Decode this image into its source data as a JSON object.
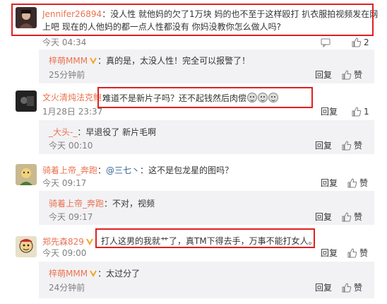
{
  "comments": [
    {
      "user": "Jennifer26894",
      "text1": "没人性 就他妈的欠了1万块 妈的也不至于这样殴打 扒衣服拍视频发在网",
      "text2": "上吧  现在的人他妈的都一点人性都没有  你妈没教你怎么做人吗?",
      "time": "今天 04:34",
      "likes": "2"
    },
    {
      "user": "梓萌MMM",
      "text": "真的是，太没人性！完全可以报警了！",
      "time": "25分钟前",
      "reply": "回复",
      "like_label": "赞"
    },
    {
      "user": "文火清炖法克鲍",
      "text": "难道不是新片子吗？还不起钱然后肉偿",
      "time": "1月28日 23:37",
      "reply": "回复",
      "likes": "1"
    },
    {
      "user": "_大头-_",
      "text": "早退役了 新片毛啊",
      "time": "今天 00:10",
      "reply": "回复",
      "like_label": "赞"
    },
    {
      "user": "骑着上帝_奔跑",
      "mention": "@三七丶",
      "text": "这不是包龙星的图吗？",
      "time": "今天 09:17",
      "reply": "回复",
      "like_label": "赞"
    },
    {
      "user": "骑着上帝_奔跑",
      "text": "不对，视频",
      "time": "今天 09:17",
      "reply": "回复",
      "like_label": "赞"
    },
    {
      "user": "郑先森829",
      "text": "打人这男的我就艹了，真TM下得去手，万事不能打女人。",
      "time": "今天 09:00",
      "reply": "回复",
      "like_label": "赞"
    },
    {
      "user": "梓萌MMM",
      "text": "太过分了",
      "time": "24分钟前",
      "reply": "回复",
      "like_label": "赞"
    }
  ],
  "colors": {
    "highlight": "#e02020",
    "username": "#eb7350",
    "time": "#808080",
    "reply_bg": "#f2f2f5"
  },
  "icons": {
    "like": "thumbs-up-icon",
    "reply": "reply-icon",
    "verified": "verified-badge-icon",
    "emoji": "emoji-face-icon"
  }
}
